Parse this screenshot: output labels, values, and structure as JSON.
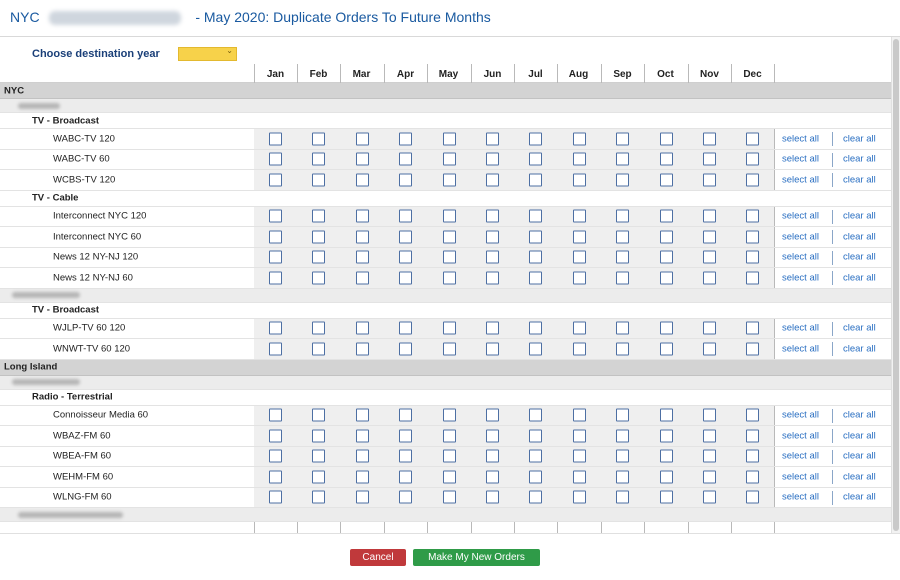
{
  "title": {
    "prefix": "NYC",
    "suffix": "- May 2020: Duplicate Orders To Future Months"
  },
  "destination": {
    "label": "Choose destination year",
    "value": ""
  },
  "months": [
    "Jan",
    "Feb",
    "Mar",
    "Apr",
    "May",
    "Jun",
    "Jul",
    "Aug",
    "Sep",
    "Oct",
    "Nov",
    "Dec"
  ],
  "links": {
    "select_all": "select all",
    "clear_all": "clear all"
  },
  "rows": [
    {
      "type": "region",
      "label": "NYC"
    },
    {
      "type": "group",
      "label": ""
    },
    {
      "type": "sub",
      "label": "TV - Broadcast"
    },
    {
      "type": "item",
      "label": "WABC-TV 120"
    },
    {
      "type": "item",
      "label": "WABC-TV 60"
    },
    {
      "type": "item",
      "label": "WCBS-TV 120"
    },
    {
      "type": "sub",
      "label": "TV - Cable"
    },
    {
      "type": "item",
      "label": "Interconnect NYC 120"
    },
    {
      "type": "item",
      "label": "Interconnect NYC 60"
    },
    {
      "type": "item",
      "label": "News 12 NY-NJ 120"
    },
    {
      "type": "item",
      "label": "News 12 NY-NJ 60"
    },
    {
      "type": "group",
      "label": ""
    },
    {
      "type": "sub",
      "label": "TV - Broadcast"
    },
    {
      "type": "item",
      "label": "WJLP-TV 60 120"
    },
    {
      "type": "item",
      "label": "WNWT-TV 60 120"
    },
    {
      "type": "region",
      "label": "Long Island"
    },
    {
      "type": "group",
      "label": ""
    },
    {
      "type": "sub",
      "label": "Radio - Terrestrial"
    },
    {
      "type": "item",
      "label": "Connoisseur Media 60"
    },
    {
      "type": "item",
      "label": "WBAZ-FM 60"
    },
    {
      "type": "item",
      "label": "WBEA-FM 60"
    },
    {
      "type": "item",
      "label": "WEHM-FM 60"
    },
    {
      "type": "item",
      "label": "WLNG-FM 60"
    },
    {
      "type": "group",
      "label": ""
    }
  ],
  "buttons": {
    "cancel": "Cancel",
    "submit": "Make My New Orders"
  }
}
